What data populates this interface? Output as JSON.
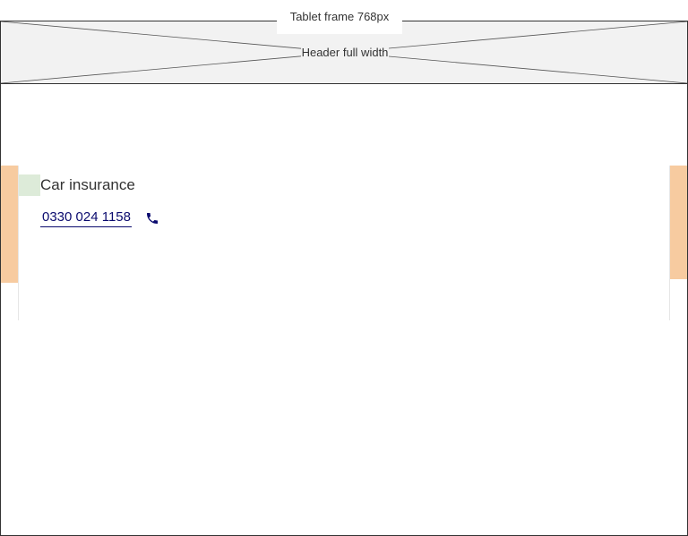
{
  "frame": {
    "label": "Tablet frame 768px"
  },
  "header": {
    "label": "Header full width"
  },
  "content": {
    "title": "Car insurance",
    "phone_number": "0330 024 1158",
    "phone_icon": "phone-icon"
  },
  "colors": {
    "guide": "#f7cba0",
    "indent": "#ddebd9",
    "link": "#0a0a6e",
    "header_fill": "#f2f2f2"
  }
}
